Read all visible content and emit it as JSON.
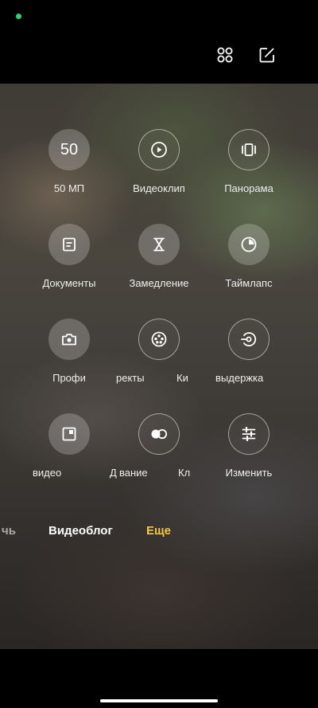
{
  "top_bar": {
    "grid_icon": "grid-icon",
    "edit_icon": "edit-icon"
  },
  "modes": [
    {
      "label": "50 МП",
      "icon": "50",
      "style": "filled"
    },
    {
      "label": "Видеоклип",
      "icon": "play-icon",
      "style": "outline"
    },
    {
      "label": "Панорама",
      "icon": "panorama-icon",
      "style": "outline"
    },
    {
      "label": "Документы",
      "icon": "document-icon",
      "style": "filled"
    },
    {
      "label": "Замедление",
      "icon": "hourglass-icon",
      "style": "filled"
    },
    {
      "label": "Таймлапс",
      "icon": "timelapse-icon",
      "style": "filled"
    },
    {
      "label": "Профи",
      "icon": "camera-icon",
      "style": "filled"
    },
    {
      "label_a": "ректы",
      "label_b": "Ки",
      "icon": "film-reel-icon",
      "style": "outline"
    },
    {
      "label": "выдержка",
      "icon": "shutter-icon",
      "style": "outline"
    },
    {
      "label_a": "видео",
      "label_b": "Д",
      "icon": "dual-video-icon",
      "style": "filled"
    },
    {
      "label_a": "вание",
      "label_b": "Кл",
      "icon": "toggle-icon",
      "style": "outline"
    },
    {
      "label": "Изменить",
      "icon": "sliders-icon",
      "style": "outline"
    }
  ],
  "tabs": {
    "partial": "чь",
    "vlog": "Видеоблог",
    "more": "Еще",
    "active_color": "#f7c843"
  }
}
